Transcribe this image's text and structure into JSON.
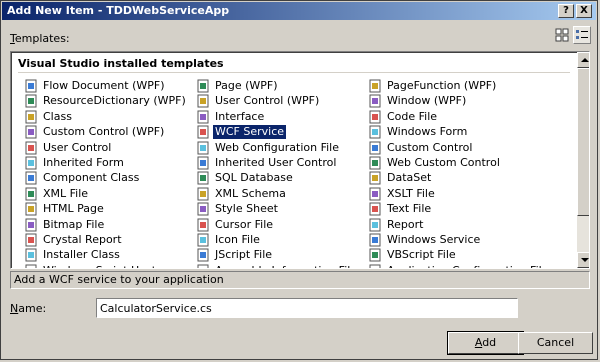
{
  "window": {
    "title": "Add New Item - TDDWebServiceApp",
    "help_label": "?",
    "close_label": "X"
  },
  "templates": {
    "label_prefix": "T",
    "label_rest": "emplates:",
    "group_header": "Visual Studio installed templates",
    "columns": [
      [
        {
          "label": "Flow Document (WPF)",
          "icon": "wpf-document-icon"
        },
        {
          "label": "ResourceDictionary (WPF)",
          "icon": "wpf-resource-icon"
        },
        {
          "label": "Class",
          "icon": "class-icon"
        },
        {
          "label": "Custom Control (WPF)",
          "icon": "wpf-control-icon"
        },
        {
          "label": "User Control",
          "icon": "user-control-icon"
        },
        {
          "label": "Inherited Form",
          "icon": "inherited-form-icon"
        },
        {
          "label": "Component Class",
          "icon": "component-icon"
        },
        {
          "label": "XML File",
          "icon": "xml-file-icon"
        },
        {
          "label": "HTML Page",
          "icon": "html-page-icon"
        },
        {
          "label": "Bitmap File",
          "icon": "bitmap-icon"
        },
        {
          "label": "Crystal Report",
          "icon": "crystal-report-icon"
        },
        {
          "label": "Installer Class",
          "icon": "installer-icon"
        },
        {
          "label": "Windows Script Host",
          "icon": "script-host-icon"
        }
      ],
      [
        {
          "label": "Page (WPF)",
          "icon": "wpf-page-icon"
        },
        {
          "label": "User Control (WPF)",
          "icon": "wpf-user-control-icon"
        },
        {
          "label": "Interface",
          "icon": "interface-icon"
        },
        {
          "label": "WCF Service",
          "icon": "wcf-service-icon",
          "selected": true
        },
        {
          "label": "Web Configuration File",
          "icon": "web-config-icon"
        },
        {
          "label": "Inherited User Control",
          "icon": "inherited-control-icon"
        },
        {
          "label": "SQL Database",
          "icon": "database-icon"
        },
        {
          "label": "XML Schema",
          "icon": "xml-schema-icon"
        },
        {
          "label": "Style Sheet",
          "icon": "style-sheet-icon"
        },
        {
          "label": "Cursor File",
          "icon": "cursor-icon"
        },
        {
          "label": "Icon File",
          "icon": "icon-file-icon"
        },
        {
          "label": "JScript File",
          "icon": "jscript-icon"
        },
        {
          "label": "Assembly Information File",
          "icon": "assembly-info-icon"
        }
      ],
      [
        {
          "label": "PageFunction (WPF)",
          "icon": "wpf-pagefunction-icon"
        },
        {
          "label": "Window (WPF)",
          "icon": "wpf-window-icon"
        },
        {
          "label": "Code File",
          "icon": "code-file-icon"
        },
        {
          "label": "Windows Form",
          "icon": "windows-form-icon"
        },
        {
          "label": "Custom Control",
          "icon": "custom-control-icon"
        },
        {
          "label": "Web Custom Control",
          "icon": "web-custom-control-icon"
        },
        {
          "label": "DataSet",
          "icon": "dataset-icon"
        },
        {
          "label": "XSLT File",
          "icon": "xslt-icon"
        },
        {
          "label": "Text File",
          "icon": "text-file-icon"
        },
        {
          "label": "Report",
          "icon": "report-icon"
        },
        {
          "label": "Windows Service",
          "icon": "windows-service-icon"
        },
        {
          "label": "VBScript File",
          "icon": "vbscript-icon"
        },
        {
          "label": "Application Configuration File",
          "icon": "app-config-icon"
        }
      ]
    ]
  },
  "description": "Add a WCF service to your application",
  "name_field": {
    "label_prefix": "N",
    "label_rest": "ame:",
    "value": "CalculatorService.cs"
  },
  "buttons": {
    "add_prefix": "A",
    "add_rest": "dd",
    "cancel": "Cancel"
  },
  "colors": {
    "title_bar": "#0a246a",
    "selection": "#0a246a",
    "dialog_face": "#d4d0c8"
  }
}
